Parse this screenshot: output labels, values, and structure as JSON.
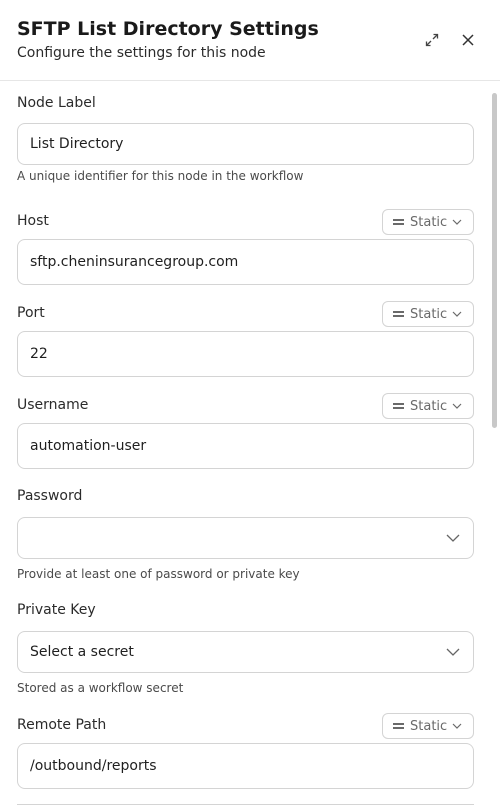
{
  "header": {
    "title": "SFTP List Directory Settings",
    "subtitle": "Configure the settings for this node",
    "expand_icon": "expand-icon",
    "close_icon": "close-icon"
  },
  "fields": {
    "node_label": {
      "label": "Node Label",
      "value": "List Directory",
      "hint": "A unique identifier for this node in the workflow"
    },
    "host": {
      "label": "Host",
      "mode": "Static",
      "value": "sftp.cheninsurancegroup.com"
    },
    "port": {
      "label": "Port",
      "mode": "Static",
      "value": "22"
    },
    "username": {
      "label": "Username",
      "mode": "Static",
      "value": "automation-user"
    },
    "password": {
      "label": "Password",
      "value": "",
      "hint": "Provide at least one of password or private key"
    },
    "private_key": {
      "label": "Private Key",
      "placeholder": "Select a secret",
      "hint": "Stored as a workflow secret"
    },
    "remote_path": {
      "label": "Remote Path",
      "mode": "Static",
      "value": "/outbound/reports"
    }
  }
}
